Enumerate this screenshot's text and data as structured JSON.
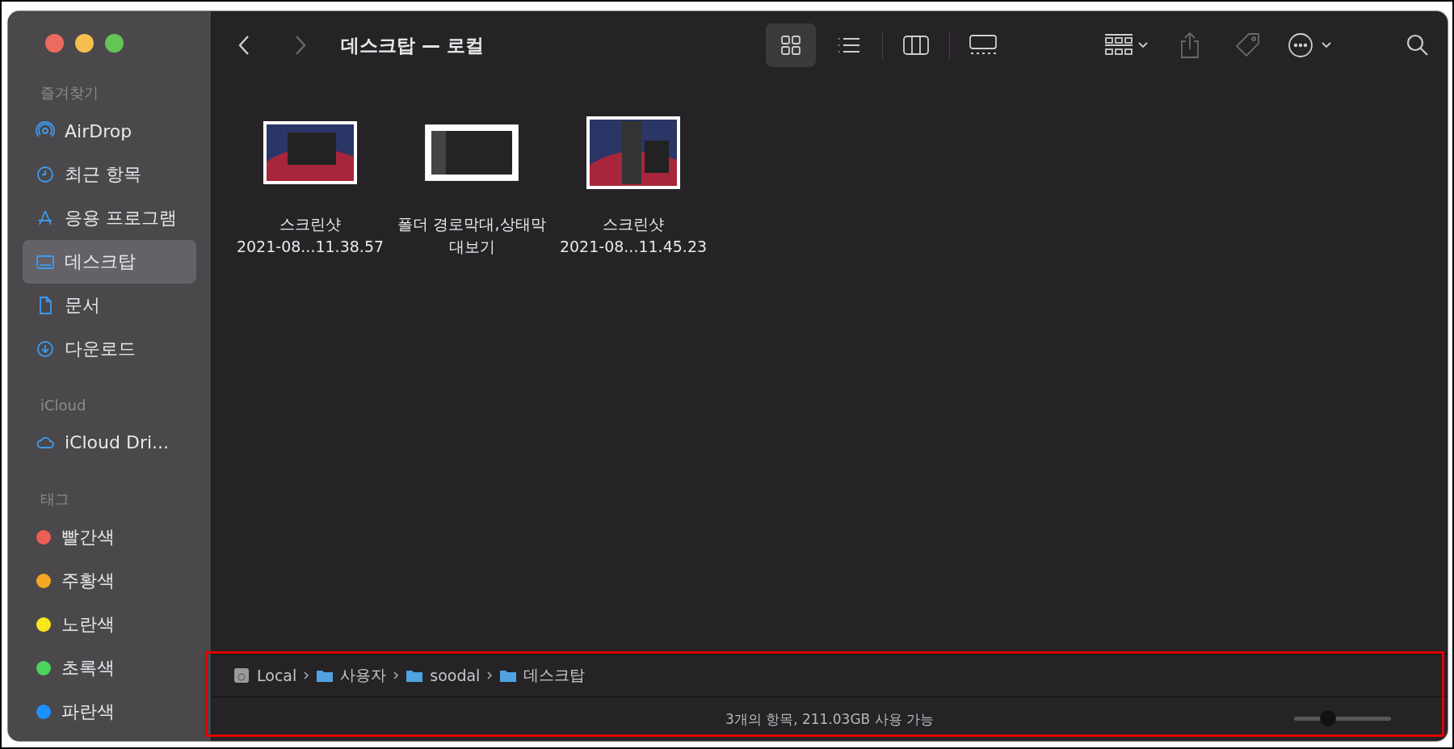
{
  "window": {
    "title": "데스크탑 — 로컬"
  },
  "sidebar": {
    "sections": [
      {
        "title": "즐겨찾기",
        "items": [
          {
            "label": "AirDrop",
            "kind": "airdrop",
            "selected": false
          },
          {
            "label": "최근 항목",
            "kind": "recent",
            "selected": false
          },
          {
            "label": "응용 프로그램",
            "kind": "apps",
            "selected": false
          },
          {
            "label": "데스크탑",
            "kind": "desktop",
            "selected": true
          },
          {
            "label": "문서",
            "kind": "document",
            "selected": false
          },
          {
            "label": "다운로드",
            "kind": "download",
            "selected": false
          }
        ]
      },
      {
        "title": "iCloud",
        "items": [
          {
            "label": "iCloud Dri...",
            "kind": "cloud",
            "selected": false
          }
        ]
      },
      {
        "title": "태그",
        "items": [
          {
            "label": "빨간색",
            "kind": "tag",
            "color": "#ec5f57",
            "selected": false
          },
          {
            "label": "주황색",
            "kind": "tag",
            "color": "#f5a623",
            "selected": false
          },
          {
            "label": "노란색",
            "kind": "tag",
            "color": "#f8e71c",
            "selected": false
          },
          {
            "label": "초록색",
            "kind": "tag",
            "color": "#4cd35b",
            "selected": false
          },
          {
            "label": "파란색",
            "kind": "tag",
            "color": "#1e90ff",
            "selected": false
          }
        ]
      }
    ]
  },
  "toolbar": {
    "view_modes": [
      {
        "kind": "icons",
        "selected": true
      },
      {
        "kind": "list",
        "selected": false
      },
      {
        "kind": "columns",
        "selected": false
      },
      {
        "kind": "gallery",
        "selected": false
      }
    ]
  },
  "files": [
    {
      "name_lines": [
        "스크린샷",
        "2021-08...11.38.57"
      ],
      "kind": "wide"
    },
    {
      "name_lines": [
        "폴더 경로막대,상태막",
        "대보기"
      ],
      "kind": "doc"
    },
    {
      "name_lines": [
        "스크린샷",
        "2021-08...11.45.23"
      ],
      "kind": "tall"
    }
  ],
  "path_bar": [
    {
      "label": "Local",
      "kind": "disk"
    },
    {
      "label": "사용자",
      "kind": "folder"
    },
    {
      "label": "soodal",
      "kind": "folder"
    },
    {
      "label": "데스크탑",
      "kind": "folder"
    }
  ],
  "status_bar": {
    "text": "3개의 항목, 211.03GB 사용 가능",
    "icon_size": {
      "level": 0.35
    }
  }
}
